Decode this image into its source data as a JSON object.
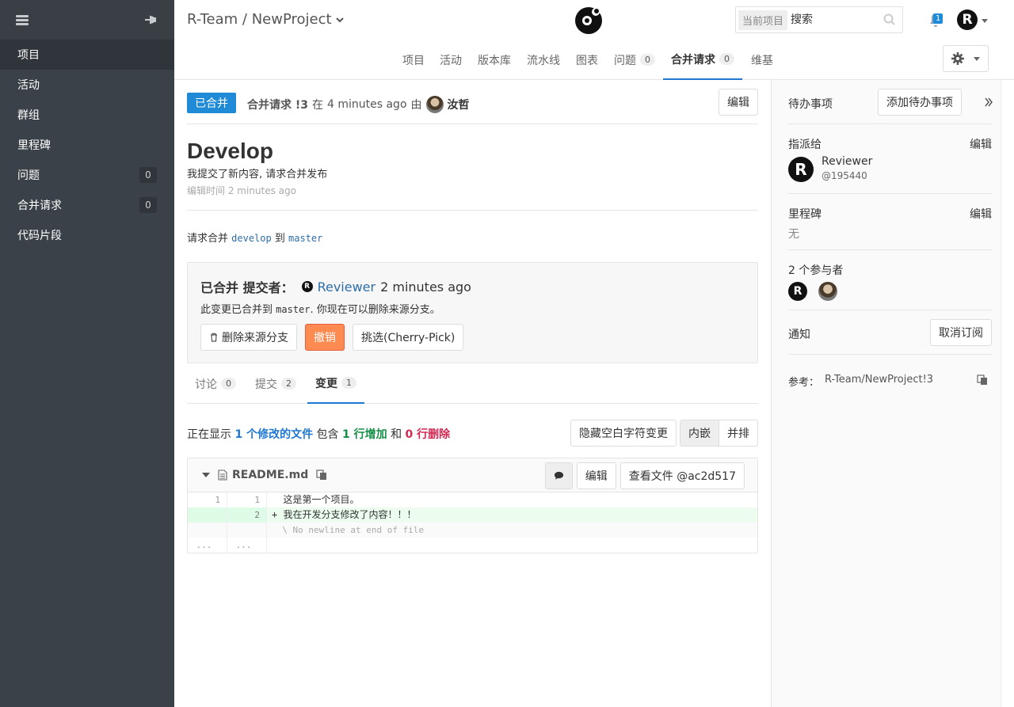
{
  "sidebar": {
    "items": [
      {
        "label": "项目",
        "count": ""
      },
      {
        "label": "活动",
        "count": ""
      },
      {
        "label": "群组",
        "count": ""
      },
      {
        "label": "里程碑",
        "count": ""
      },
      {
        "label": "问题",
        "count": "0"
      },
      {
        "label": "合并请求",
        "count": "0"
      },
      {
        "label": "代码片段",
        "count": ""
      }
    ],
    "active_index": 0
  },
  "header": {
    "title": "R-Team / NewProject",
    "search_scope": "当前项目",
    "search_placeholder": "搜索",
    "notification_count": "1",
    "user_initial": "R"
  },
  "nav_tabs": [
    {
      "label": "项目",
      "count": ""
    },
    {
      "label": "活动",
      "count": ""
    },
    {
      "label": "版本库",
      "count": ""
    },
    {
      "label": "流水线",
      "count": ""
    },
    {
      "label": "图表",
      "count": ""
    },
    {
      "label": "问题",
      "count": "0"
    },
    {
      "label": "合并请求",
      "count": "0"
    },
    {
      "label": "维基",
      "count": ""
    }
  ],
  "mr": {
    "status_badge": "已合并",
    "ref": "合并请求 !3",
    "opened_prefix": "在",
    "opened_time": "4 minutes ago",
    "by": "由",
    "author": "汝哲",
    "edit_label": "编辑",
    "title": "Develop",
    "description": "我提交了新内容, 请求合并发布",
    "edited_label": "编辑时间",
    "edited_time": "2 minutes ago",
    "request_prefix": "请求合并",
    "source_branch": "develop",
    "to_word": "到",
    "target_branch": "master"
  },
  "merge_box": {
    "head_label": "已合并 提交者：",
    "merger_initial": "R",
    "merger": "Reviewer",
    "merged_time": "2 minutes ago",
    "sub_prefix": "此变更已合并到",
    "sub_branch": "master",
    "sub_suffix": ". 你现在可以删除来源分支。",
    "delete_branch": "删除来源分支",
    "revert": "撤销",
    "cherry_pick": "挑选(Cherry-Pick)"
  },
  "sub_tabs": [
    {
      "label": "讨论",
      "count": "0"
    },
    {
      "label": "提交",
      "count": "2"
    },
    {
      "label": "变更",
      "count": "1"
    }
  ],
  "diff_stats": {
    "prefix": "正在显示",
    "files": "1 个修改的文件",
    "contains": "包含",
    "additions": "1 行增加",
    "and": "和",
    "deletions": "0 行删除",
    "hide_whitespace": "隐藏空白字符变更",
    "inline": "内嵌",
    "parallel": "并排"
  },
  "file": {
    "name": "README.md",
    "edit": "编辑",
    "view_file": "查看文件 @ac2d517",
    "lines": [
      {
        "old": "1",
        "new": "1",
        "text": "  这是第一个项目。",
        "type": "normal"
      },
      {
        "old": "",
        "new": "2",
        "text": "+ 我在开发分支修改了内容！！！",
        "type": "added"
      },
      {
        "old": "",
        "new": "",
        "text": "  \\ No newline at end of file",
        "type": "nonl"
      },
      {
        "old": "...",
        "new": "...",
        "text": "",
        "type": "expand"
      }
    ]
  },
  "right_sidebar": {
    "todo_label": "待办事项",
    "add_todo": "添加待办事项",
    "assignee_label": "指派给",
    "edit": "编辑",
    "assignee_name": "Reviewer",
    "assignee_handle": "@195440",
    "assignee_initial": "R",
    "milestone_label": "里程碑",
    "milestone_value": "无",
    "participants_label": "2 个参与者",
    "participant_initial": "R",
    "notify_label": "通知",
    "unsubscribe": "取消订阅",
    "reference_label": "参考：",
    "reference_value": "R-Team/NewProject!3"
  },
  "colors": {
    "sidebar_bg": "#3a4149",
    "accent_blue": "#1f78d1",
    "merged_badge": "#1f8ad6",
    "revert_orange": "#fc8a51",
    "added_green": "#168f48",
    "deleted_red": "#d22852"
  }
}
